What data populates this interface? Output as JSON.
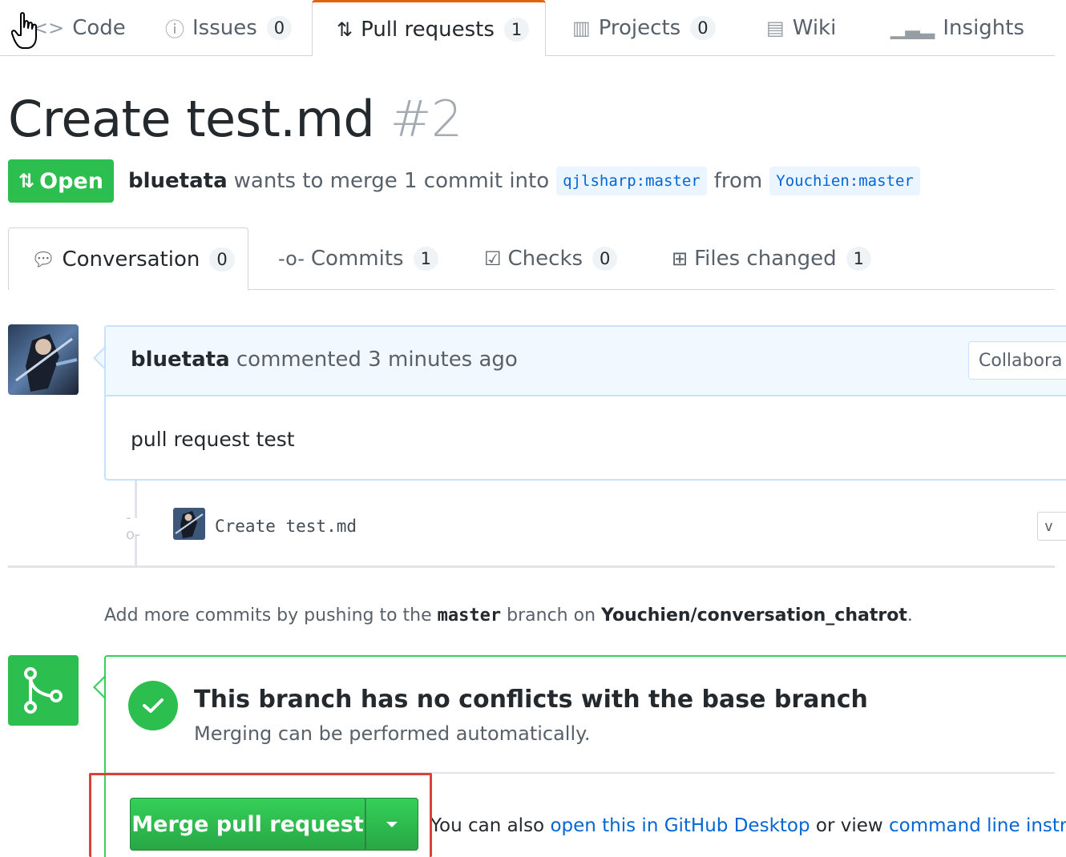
{
  "repo_nav": {
    "tabs": [
      {
        "label": "Code",
        "icon": "code-icon",
        "counter": null
      },
      {
        "label": "Issues",
        "icon": "issue-opened-icon",
        "counter": "0"
      },
      {
        "label": "Pull requests",
        "icon": "git-pull-request-icon",
        "counter": "1",
        "selected": true
      },
      {
        "label": "Projects",
        "icon": "project-icon",
        "counter": "0"
      },
      {
        "label": "Wiki",
        "icon": "book-icon",
        "counter": null
      },
      {
        "label": "Insights",
        "icon": "graph-icon",
        "counter": null
      }
    ]
  },
  "pr": {
    "title": "Create test.md",
    "number": "#2",
    "state": "Open",
    "author": "bluetata",
    "merge_text": "wants to merge 1 commit into",
    "base_ref": "qjlsharp:master",
    "from_text": "from",
    "head_ref": "Youchien:master"
  },
  "pr_tabs": [
    {
      "label": "Conversation",
      "icon": "comment-discussion-icon",
      "counter": "0",
      "selected": true
    },
    {
      "label": "Commits",
      "icon": "git-commit-icon",
      "counter": "1"
    },
    {
      "label": "Checks",
      "icon": "checklist-icon",
      "counter": "0"
    },
    {
      "label": "Files changed",
      "icon": "diff-icon",
      "counter": "1"
    }
  ],
  "comment": {
    "author": "bluetata",
    "action": "commented 3 minutes ago",
    "role": "Collabora",
    "body": "pull request test"
  },
  "commit": {
    "message": "Create test.md",
    "sha": "v"
  },
  "push_hint": {
    "prefix": "Add more commits by pushing to the",
    "branch": "master",
    "middle": "branch on",
    "repo": "Youchien/conversation_chatrot",
    "suffix": "."
  },
  "merge": {
    "heading": "This branch has no conflicts with the base branch",
    "subtext": "Merging can be performed automatically.",
    "button_label": "Merge pull request",
    "alt_prefix": "You can also",
    "alt_link1": "open this in GitHub Desktop",
    "alt_middle": "or view",
    "alt_link2": "command line instructio"
  },
  "colors": {
    "open_green": "#2cbe4e",
    "link_blue": "#0366d6",
    "highlight_red": "#d9413c",
    "tab_accent": "#e36209"
  }
}
